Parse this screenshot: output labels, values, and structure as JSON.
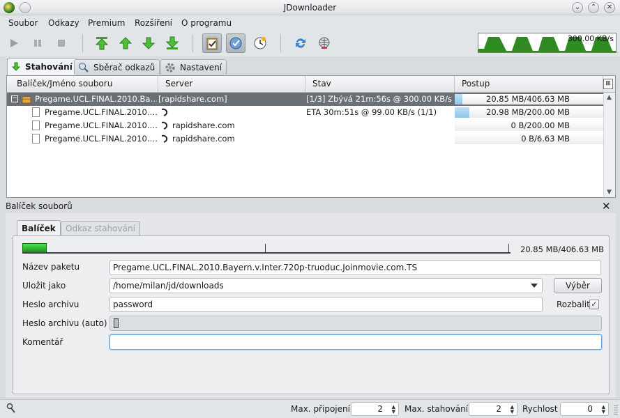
{
  "window": {
    "title": "JDownloader"
  },
  "menu": [
    "Soubor",
    "Odkazy",
    "Premium",
    "Rozšíření",
    "O programu"
  ],
  "toolbar": {
    "icons": [
      "play-icon",
      "pause-icon",
      "stop-icon",
      "move-top-icon",
      "move-up-icon",
      "move-down-icon",
      "move-bottom-icon",
      "clipboard-icon",
      "reconnect-icon",
      "clock-icon",
      "refresh-icon",
      "globe-icon"
    ],
    "speed_label": "300.00 KB/s"
  },
  "tabs": [
    {
      "label": "Stahování",
      "active": true
    },
    {
      "label": "Sběrač odkazů",
      "active": false
    },
    {
      "label": "Nastavení",
      "active": false
    }
  ],
  "table": {
    "headers": [
      "Balíček/Jméno souboru",
      "Server",
      "Stav",
      "Postup"
    ],
    "rows": [
      {
        "name": "Pregame.UCL.FINAL.2010.Ba…",
        "server": "[rapidshare.com]",
        "status": "[1/3] Zbývá 21m:56s @ 300.00 KB/s",
        "progress": "20.85 MB/406.63 MB",
        "fraction": 0.05,
        "type": "package"
      },
      {
        "name": "Pregame.UCL.FINAL.2010.…",
        "server": "",
        "status": "ETA 30m:51s @ 99.00 KB/s (1/1)",
        "progress": "20.98 MB/200.00 MB",
        "fraction": 0.1,
        "type": "file"
      },
      {
        "name": "Pregame.UCL.FINAL.2010.…",
        "server": "rapidshare.com",
        "status": "",
        "progress": "0 B/200.00 MB",
        "fraction": 0,
        "type": "file"
      },
      {
        "name": "Pregame.UCL.FINAL.2010.…",
        "server": "rapidshare.com",
        "status": "",
        "progress": "0 B/6.63 MB",
        "fraction": 0,
        "type": "file"
      }
    ]
  },
  "panel": {
    "title": "Balíček souborů",
    "subtabs": [
      {
        "label": "Balíček",
        "active": true
      },
      {
        "label": "Odkaz stahování",
        "active": false
      }
    ],
    "progress_text": "20.85 MB/406.63 MB",
    "progress_fraction": 0.05,
    "labels": {
      "name": "Název paketu",
      "save_as": "Uložit jako",
      "password": "Heslo archivu",
      "password_auto": "Heslo archivu (auto)",
      "comment": "Komentář"
    },
    "values": {
      "name": "Pregame.UCL.FINAL.2010.Bayern.v.Inter.720p-truoduc.Joinmovie.com.TS",
      "save_as": "/home/milan/jd/downloads",
      "password": "password",
      "password_auto": "",
      "comment": ""
    },
    "browse_button": "Výběr",
    "extract_label": "Rozbalit",
    "extract_checked": true
  },
  "statusbar": {
    "max_connections_label": "Max. připojení",
    "max_connections": "2",
    "max_downloads_label": "Max. stahování",
    "max_downloads": "2",
    "speed_label": "Rychlost",
    "speed": "0"
  }
}
